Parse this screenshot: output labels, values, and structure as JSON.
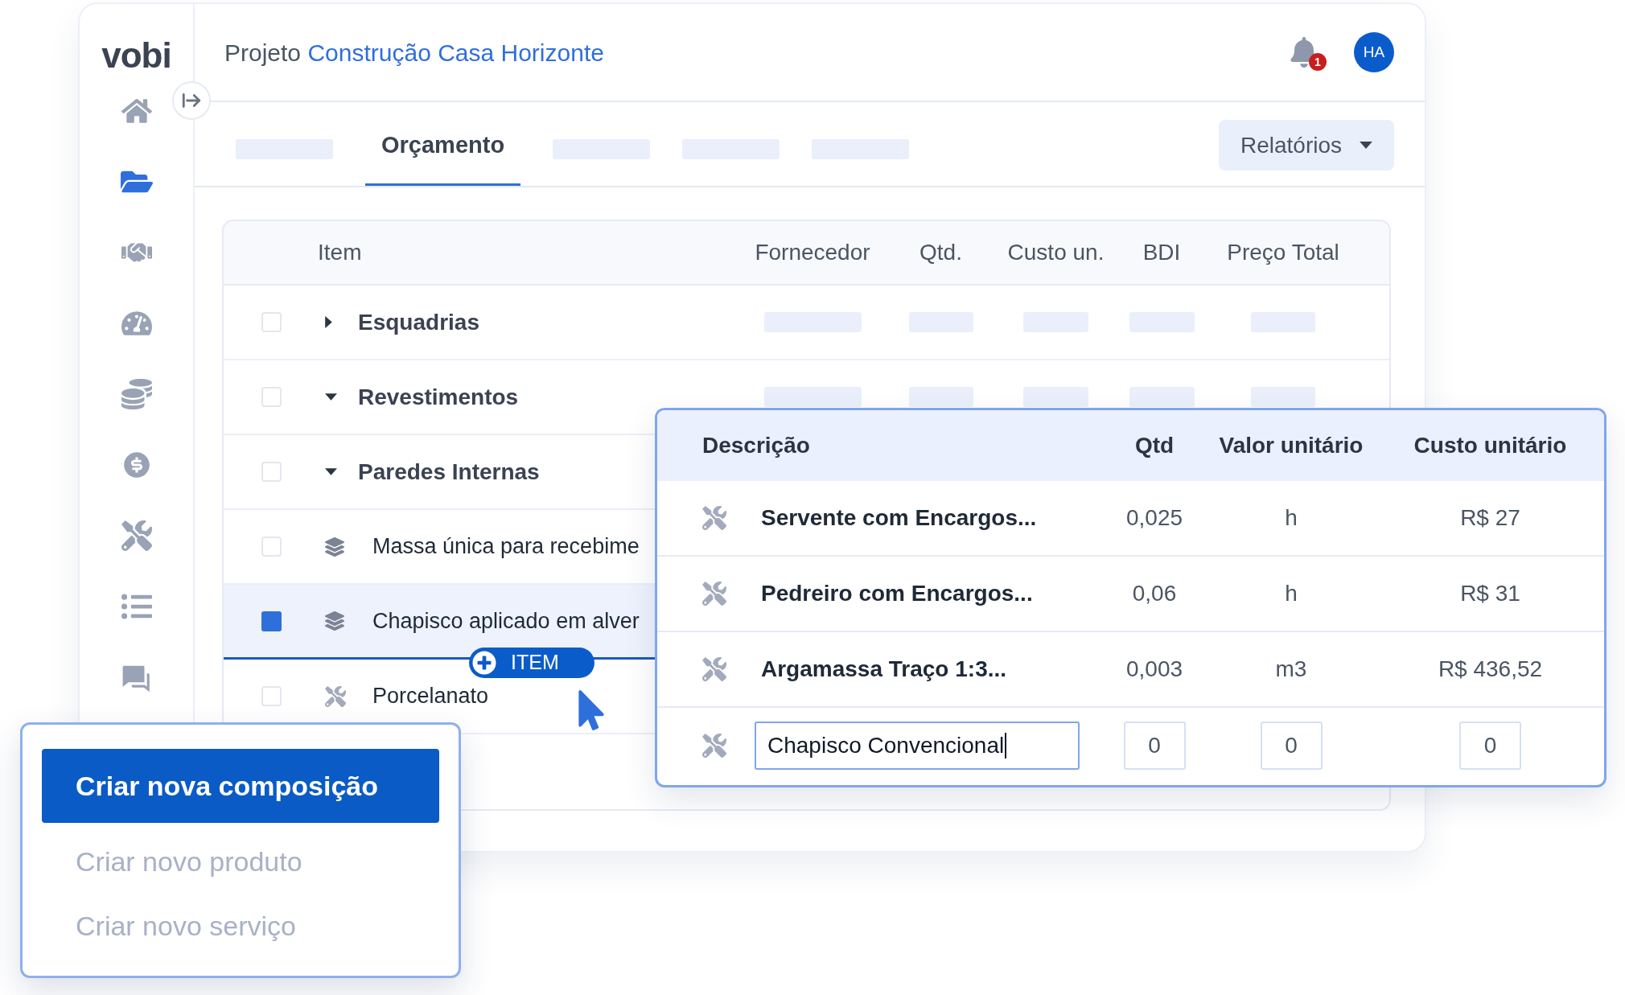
{
  "logo": "vobi",
  "sidebar": {
    "items": [
      {
        "selected": false
      },
      {
        "selected": true
      },
      {
        "selected": false
      },
      {
        "selected": false
      },
      {
        "selected": false
      },
      {
        "selected": false
      },
      {
        "selected": false
      },
      {
        "selected": false
      },
      {
        "selected": false
      }
    ]
  },
  "header": {
    "title_prefix": "Projeto",
    "project": "Construção Casa Horizonte",
    "notification_count": "1",
    "avatar": "HA"
  },
  "tabs": [
    {
      "kind": "placeholder",
      "selected": false
    },
    {
      "kind": "tab",
      "label": "Orçamento",
      "selected": true
    },
    {
      "kind": "placeholder",
      "selected": false
    },
    {
      "kind": "placeholder",
      "selected": false
    },
    {
      "kind": "placeholder",
      "selected": false
    }
  ],
  "reports_button": "Relatórios",
  "table": {
    "columns": [
      "Item",
      "Fornecedor",
      "Qtd.",
      "Custo un.",
      "BDI",
      "Preço Total"
    ],
    "rows": [
      {
        "kind": "group",
        "name": "Esquadrias",
        "expanded": false,
        "selected": false,
        "skeleton": true
      },
      {
        "kind": "group",
        "name": "Revestimentos",
        "expanded": true,
        "selected": false,
        "skeleton": true
      },
      {
        "kind": "group",
        "name": "Paredes Internas",
        "expanded": true,
        "selected": false,
        "skeleton": false
      },
      {
        "kind": "composition",
        "name": "Massa única para recebime",
        "selected": false,
        "skeleton": false
      },
      {
        "kind": "composition",
        "name": "Chapisco aplicado em alver",
        "selected": true,
        "skeleton": false
      },
      {
        "kind": "service",
        "name": "Porcelanato",
        "selected": false,
        "skeleton": false
      }
    ]
  },
  "drag_chip": "ITEM",
  "composition": {
    "columns": [
      "Descrição",
      "Qtd",
      "Valor unitário",
      "Custo unitário"
    ],
    "rows": [
      {
        "kind": "text",
        "description": "Servente com Encargos...",
        "qty": "0,025",
        "unit": "h",
        "cost": "R$ 27"
      },
      {
        "kind": "text",
        "description": "Pedreiro com Encargos...",
        "qty": "0,06",
        "unit": "h",
        "cost": "R$ 31"
      },
      {
        "kind": "text",
        "description": "Argamassa Traço 1:3...",
        "qty": "0,003",
        "unit": "m3",
        "cost": "R$ 436,52"
      },
      {
        "kind": "input",
        "description": "Chapisco Convencional",
        "qty": "0",
        "unit": "0",
        "cost": "0"
      }
    ]
  },
  "menu": {
    "items": [
      {
        "label": "Criar nova composição",
        "selected": true
      },
      {
        "label": "Criar novo produto",
        "selected": false
      },
      {
        "label": "Criar novo serviço",
        "selected": false
      }
    ]
  }
}
